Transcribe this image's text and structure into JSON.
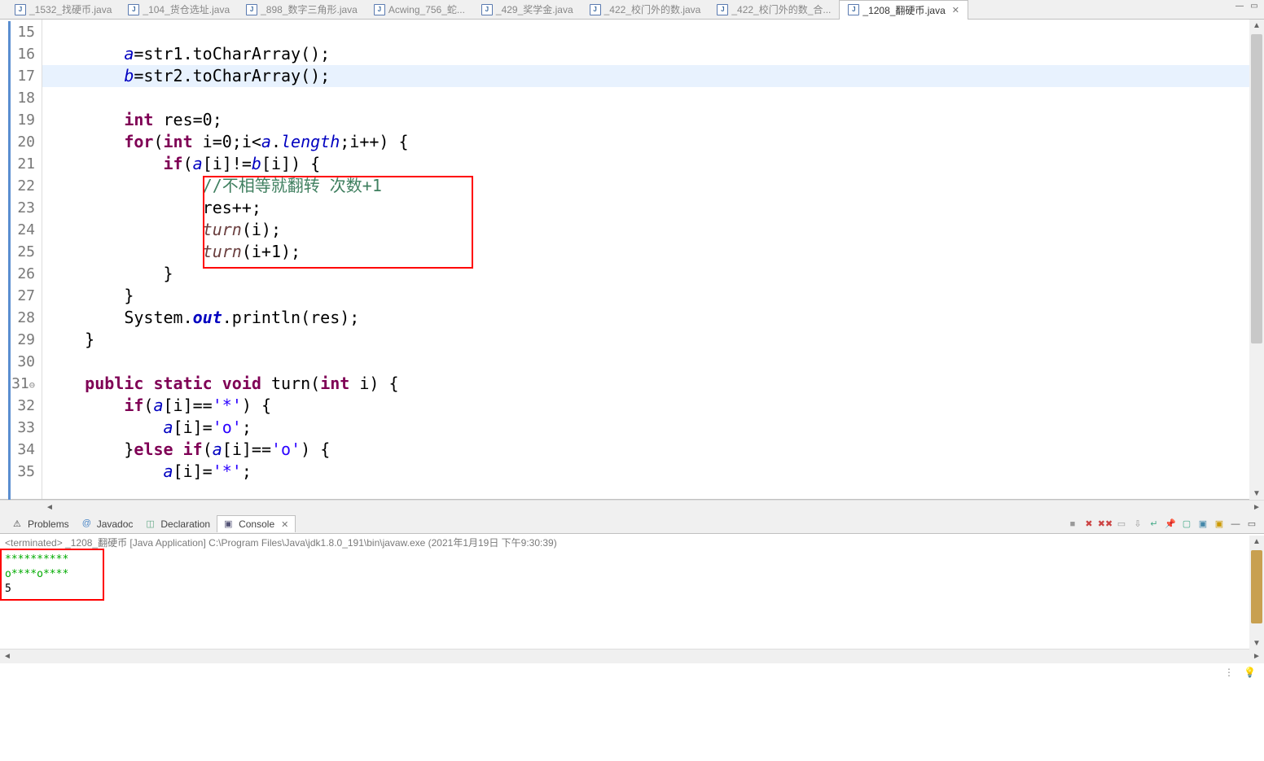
{
  "tabs": [
    {
      "label": "_1532_找硬币.java"
    },
    {
      "label": "_104_货仓选址.java"
    },
    {
      "label": "_898_数字三角形.java"
    },
    {
      "label": "Acwing_756_蛇..."
    },
    {
      "label": "_429_奖学金.java"
    },
    {
      "label": "_422_校门外的数.java"
    },
    {
      "label": "_422_校门外的数_合..."
    },
    {
      "label": "_1208_翻硬币.java"
    }
  ],
  "code": {
    "l15": "",
    "l16_a": "a",
    "l16_b": "=str1.toCharArray();",
    "l17_a": "b",
    "l17_b": "=str2.toCharArray();",
    "l18": "",
    "l19_kw": "int",
    "l19_b": " res=0;",
    "l20_kw1": "for",
    "l20_a": "(",
    "l20_kw2": "int",
    "l20_b": " i=0;i<",
    "l20_fld": "a",
    "l20_c": ".",
    "l20_len": "length",
    "l20_d": ";i++) {",
    "l21_kw": "if",
    "l21_a": "(",
    "l21_fld1": "a",
    "l21_b": "[i]!=",
    "l21_fld2": "b",
    "l21_c": "[i]) {",
    "l22_cm": "//不相等就翻转 次数+1",
    "l23": "res++;",
    "l24_fn": "turn",
    "l24_a": "(i);",
    "l25_fn": "turn",
    "l25_a": "(i+1);",
    "l26": "}",
    "l27": "}",
    "l28_a": "System.",
    "l28_out": "out",
    "l28_b": ".println(res);",
    "l29": "}",
    "l30": "",
    "l31_kw1": "public",
    "l31_kw2": "static",
    "l31_kw3": "void",
    "l31_a": " turn(",
    "l31_kw4": "int",
    "l31_b": " i) {",
    "l32_kw": "if",
    "l32_a": "(",
    "l32_fld": "a",
    "l32_b": "[i]==",
    "l32_str": "'*'",
    "l32_c": ") {",
    "l33_fld": "a",
    "l33_a": "[i]=",
    "l33_str": "'o'",
    "l33_b": ";",
    "l34_a": "}",
    "l34_kw1": "else",
    "l34_kw2": "if",
    "l34_b": "(",
    "l34_fld": "a",
    "l34_c": "[i]==",
    "l34_str": "'o'",
    "l34_d": ") {",
    "l35_fld": "a",
    "l35_a": "[i]=",
    "l35_str": "'*'",
    "l35_b": ";"
  },
  "lines": [
    "15",
    "16",
    "17",
    "18",
    "19",
    "20",
    "21",
    "22",
    "23",
    "24",
    "25",
    "26",
    "27",
    "28",
    "29",
    "30",
    "31",
    "32",
    "33",
    "34",
    "35"
  ],
  "line31_dec": "31",
  "panels": {
    "problems": "Problems",
    "javadoc": "Javadoc",
    "declaration": "Declaration",
    "console": "Console"
  },
  "console": {
    "header": "<terminated> _1208_翻硬币 [Java Application] C:\\Program Files\\Java\\jdk1.8.0_191\\bin\\javaw.exe (2021年1月19日 下午9:30:39)",
    "line1": "**********",
    "line2": "o****o****",
    "line3": "5"
  },
  "java_icon_char": "J",
  "close_x": "✕"
}
